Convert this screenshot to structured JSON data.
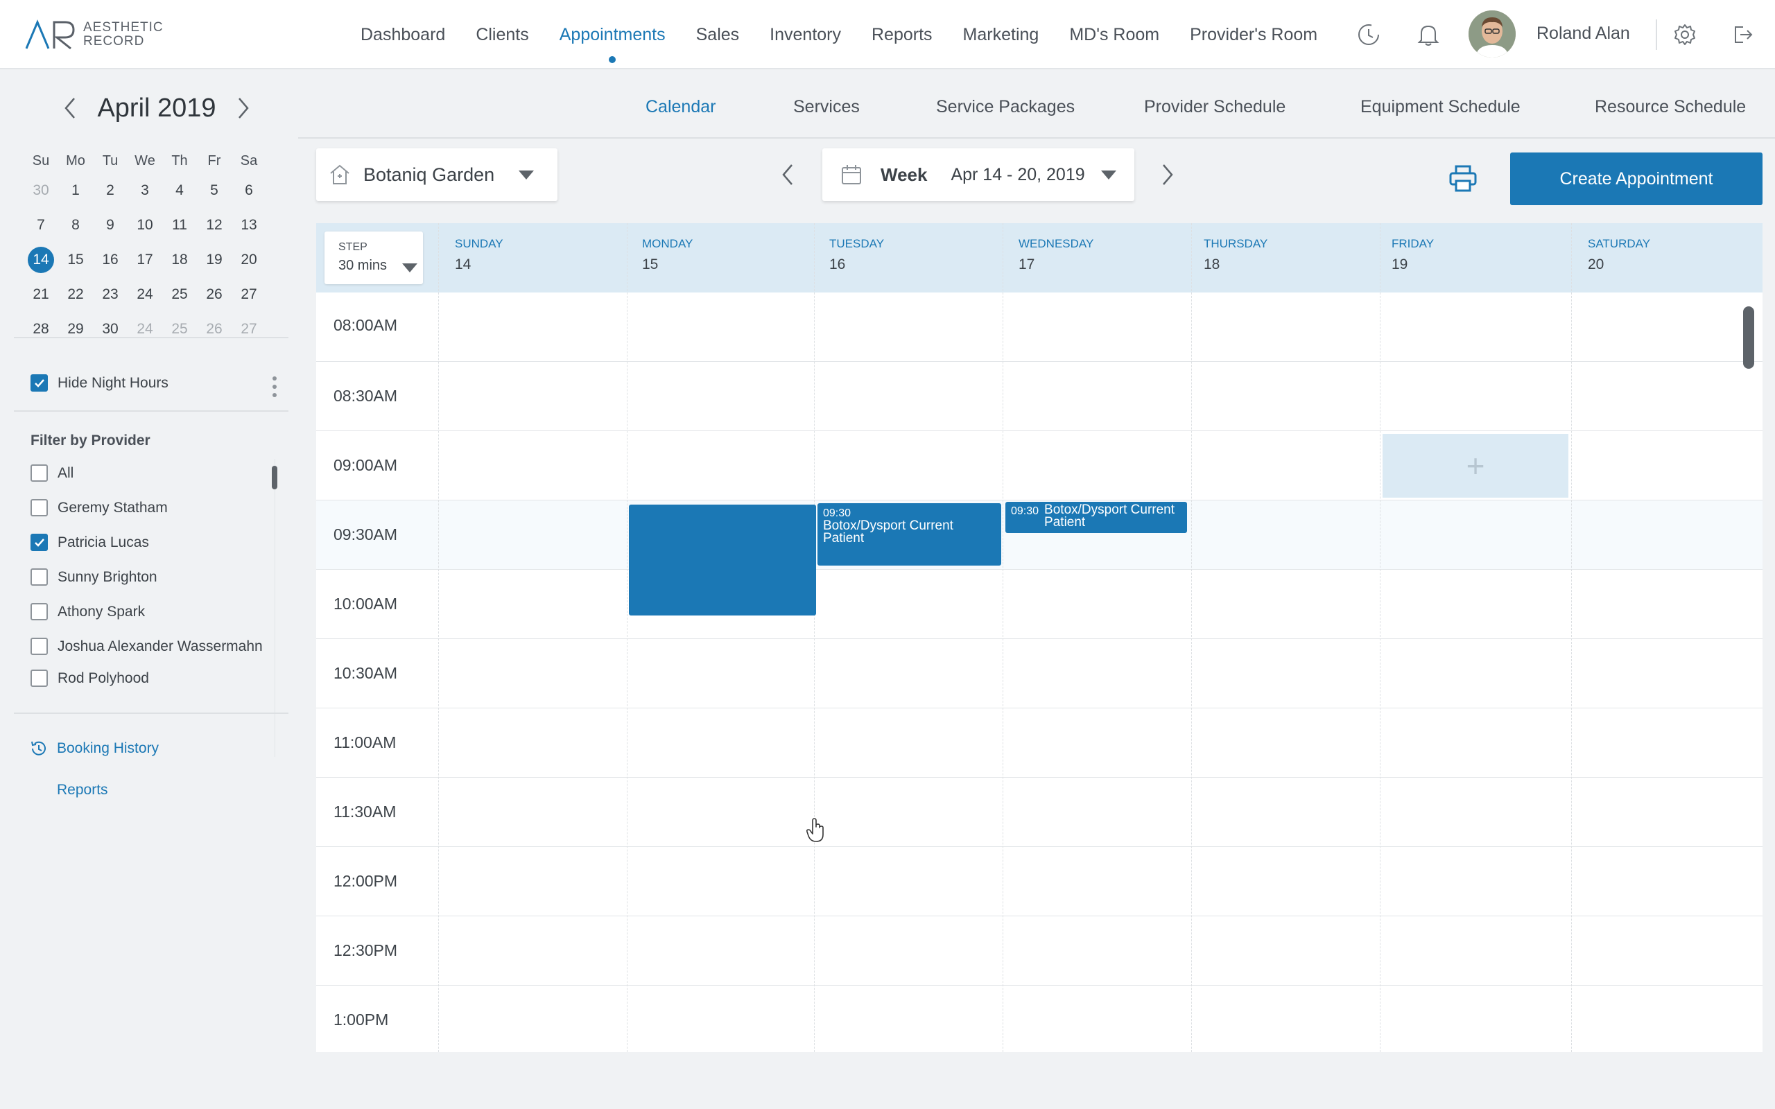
{
  "app": {
    "logo_line1": "AESTHETIC",
    "logo_line2": "RECORD",
    "accent_color": "#1b78b5"
  },
  "nav": {
    "items": [
      "Dashboard",
      "Clients",
      "Appointments",
      "Sales",
      "Inventory",
      "Reports",
      "Marketing",
      "MD's Room",
      "Provider's Room"
    ],
    "active": "Appointments"
  },
  "user": {
    "name": "Roland Alan"
  },
  "subnav": {
    "items": [
      "Calendar",
      "Services",
      "Service Packages",
      "Provider Schedule",
      "Equipment Schedule",
      "Resource Schedule"
    ],
    "active": "Calendar"
  },
  "mini_calendar": {
    "title": "April 2019",
    "weekdays": [
      "Su",
      "Mo",
      "Tu",
      "We",
      "Th",
      "Fr",
      "Sa"
    ],
    "weeks": [
      [
        "30",
        "1",
        "2",
        "3",
        "4",
        "5",
        "6"
      ],
      [
        "7",
        "8",
        "9",
        "10",
        "11",
        "12",
        "13"
      ],
      [
        "14",
        "15",
        "16",
        "17",
        "18",
        "19",
        "20"
      ],
      [
        "21",
        "22",
        "23",
        "24",
        "25",
        "26",
        "27"
      ],
      [
        "28",
        "29",
        "30",
        "24",
        "25",
        "26",
        "27"
      ]
    ],
    "selected": "14"
  },
  "options": {
    "hide_night_hours_label": "Hide Night Hours",
    "hide_night_hours": true
  },
  "filter": {
    "title": "Filter by Provider",
    "providers": [
      {
        "name": "All",
        "checked": false
      },
      {
        "name": "Geremy Statham",
        "checked": false
      },
      {
        "name": "Patricia Lucas",
        "checked": true
      },
      {
        "name": "Sunny Brighton",
        "checked": false
      },
      {
        "name": "Athony Spark",
        "checked": false
      },
      {
        "name": "Joshua Alexander Wassermahn",
        "checked": false
      },
      {
        "name": "Rod Polyhood",
        "checked": false
      }
    ]
  },
  "links": {
    "booking_history": "Booking History",
    "reports": "Reports"
  },
  "toolbar": {
    "location": "Botaniq Garden",
    "view": "Week",
    "range": "Apr 14 - 20, 2019",
    "create_label": "Create Appointment"
  },
  "calendar": {
    "step_label": "STEP",
    "step_value": "30 mins",
    "days": [
      {
        "name": "SUNDAY",
        "num": "14"
      },
      {
        "name": "MONDAY",
        "num": "15"
      },
      {
        "name": "TUESDAY",
        "num": "16"
      },
      {
        "name": "WEDNESDAY",
        "num": "17"
      },
      {
        "name": "THURSDAY",
        "num": "18"
      },
      {
        "name": "FRIDAY",
        "num": "19"
      },
      {
        "name": "SATURDAY",
        "num": "20"
      }
    ],
    "times": [
      "08:00AM",
      "08:30AM",
      "09:00AM",
      "09:30AM",
      "10:00AM",
      "10:30AM",
      "11:00AM",
      "11:30AM",
      "12:00PM",
      "12:30PM",
      "1:00PM"
    ],
    "add_symbol": "+",
    "appointments": [
      {
        "day": "MONDAY",
        "time": "",
        "title": ""
      },
      {
        "day": "TUESDAY",
        "time": "09:30",
        "title": "Botox/Dysport Current Patient"
      },
      {
        "day": "WEDNESDAY",
        "time": "09:30",
        "title": "Botox/Dysport Current Patient"
      }
    ]
  }
}
